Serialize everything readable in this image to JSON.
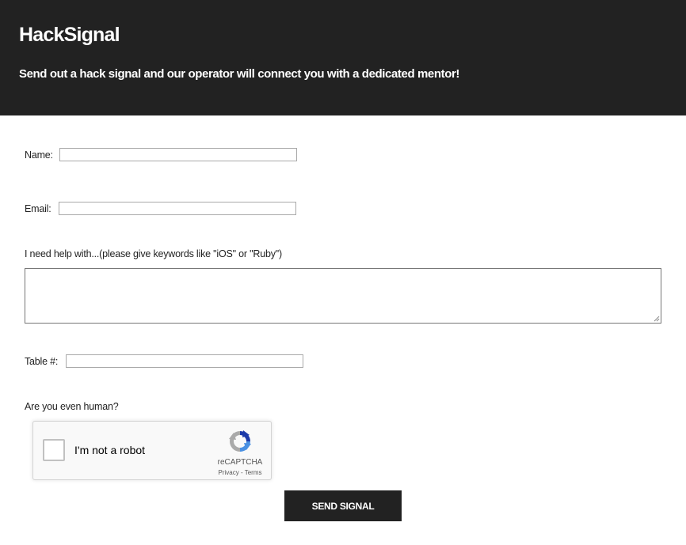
{
  "header": {
    "title": "HackSignal",
    "subtitle": "Send out a hack signal and our operator will connect you with a dedicated mentor!"
  },
  "form": {
    "name_label": "Name:",
    "name_value": "",
    "email_label": "Email:",
    "email_value": "",
    "help_label": "I need help with...(please give keywords like \"iOS\" or \"Ruby\")",
    "help_value": "",
    "table_label": "Table #:",
    "table_value": "",
    "human_label": "Are you even human?",
    "submit_label": "SEND SIGNAL"
  },
  "captcha": {
    "checkbox_label": "I'm not a robot",
    "brand": "reCAPTCHA",
    "privacy": "Privacy",
    "separator": " - ",
    "terms": "Terms",
    "icon": "recaptcha-logo-icon"
  },
  "colors": {
    "header_bg": "#222222",
    "header_text": "#ffffff",
    "button_bg": "#222222",
    "recaptcha_blue": "#4a90e2",
    "recaptcha_dark_blue": "#1c3aa9",
    "recaptcha_gray": "#aaaaaa"
  }
}
